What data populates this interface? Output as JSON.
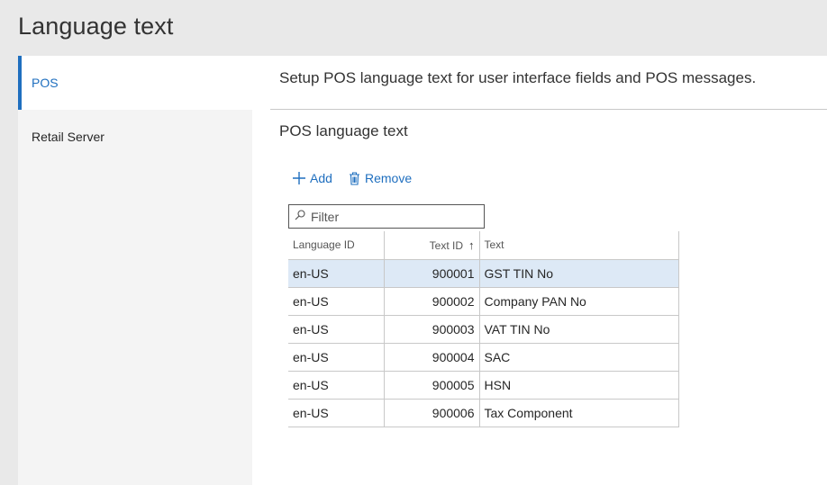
{
  "page": {
    "title": "Language text"
  },
  "nav": {
    "items": [
      {
        "label": "POS",
        "selected": true
      },
      {
        "label": "Retail Server",
        "selected": false
      }
    ]
  },
  "content": {
    "description": "Setup POS language text for user interface fields and POS messages.",
    "section_title": "POS language text",
    "toolbar": {
      "add_label": "Add",
      "remove_label": "Remove"
    },
    "filter": {
      "placeholder": "Filter",
      "value": ""
    },
    "grid": {
      "columns": [
        "Language ID",
        "Text ID",
        "Text"
      ],
      "sort_indicator": "↑",
      "rows": [
        {
          "language_id": "en-US",
          "text_id": "900001",
          "text": "GST TIN No",
          "selected": true
        },
        {
          "language_id": "en-US",
          "text_id": "900002",
          "text": "Company PAN No"
        },
        {
          "language_id": "en-US",
          "text_id": "900003",
          "text": "VAT TIN No"
        },
        {
          "language_id": "en-US",
          "text_id": "900004",
          "text": "SAC"
        },
        {
          "language_id": "en-US",
          "text_id": "900005",
          "text": "HSN"
        },
        {
          "language_id": "en-US",
          "text_id": "900006",
          "text": "Tax Component"
        }
      ]
    }
  },
  "colors": {
    "accent": "#1f6fbf",
    "selected_row": "#dde9f6",
    "header_bg": "#e9e9e9",
    "nav_bg": "#f4f4f4"
  }
}
